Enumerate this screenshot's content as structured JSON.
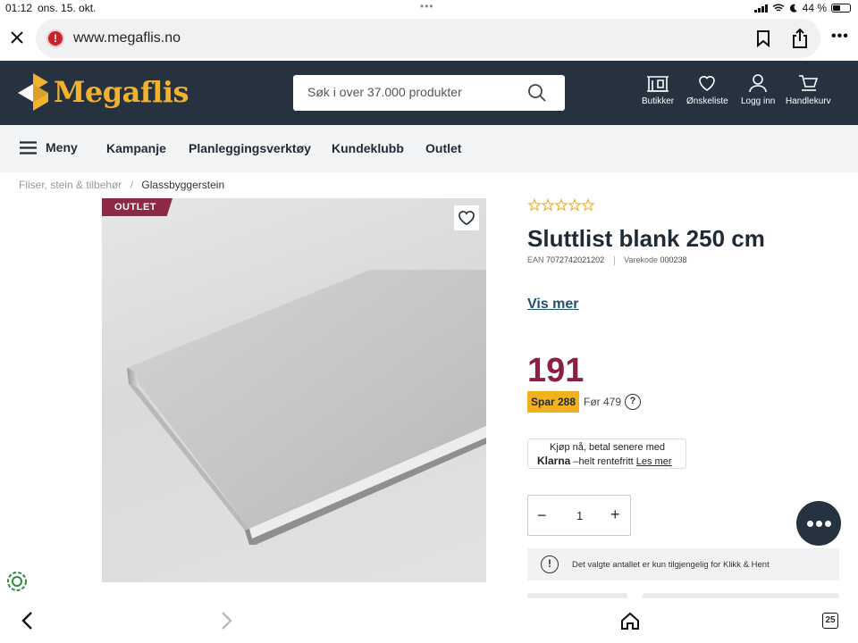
{
  "status": {
    "time": "01:12",
    "date": "ons. 15. okt.",
    "battery": "44 %",
    "battery_level": 0.44
  },
  "browser": {
    "url": "www.megaflis.no",
    "tab_count": "25"
  },
  "header": {
    "logo_text": "Megaflis",
    "search_placeholder": "Søk i over 37.000 produkter",
    "nav": [
      {
        "label": "Butikker",
        "icon": "store-icon"
      },
      {
        "label": "Ønskeliste",
        "icon": "heart-icon"
      },
      {
        "label": "Logg inn",
        "icon": "user-icon"
      },
      {
        "label": "Handlekurv",
        "icon": "cart-icon"
      }
    ]
  },
  "main_nav": {
    "menu_label": "Meny",
    "links": [
      "Kampanje",
      "Planleggingsverktøy",
      "Kundeklubb",
      "Outlet"
    ]
  },
  "breadcrumb": {
    "parent": "Fliser, stein & tilbehør",
    "separator": "/",
    "current": "Glassbyggerstein"
  },
  "product": {
    "badge": "OUTLET",
    "rating_stars": 5,
    "rating_value": 0,
    "title": "Sluttlist blank 250 cm",
    "ean_label": "EAN",
    "ean": "7072742021202",
    "sku_label": "Varekode",
    "sku": "000238",
    "vis_mer": "Vis mer",
    "price": "191",
    "save_label": "Spar 288",
    "before_price": "Før 479",
    "help_symbol": "?",
    "klarna": {
      "line1": "Kjøp nå, betal senere med",
      "brand": "Klarna",
      "line2": "–helt rentefritt",
      "link": "Les mer"
    },
    "quantity": "1",
    "notice": "Det valgte antallet er kun tilgjengelig for Klikk & Hent"
  },
  "colors": {
    "header_bg": "#263240",
    "brand_gold": "#f2b230",
    "price": "#8d1f44",
    "badge": "#8d2846",
    "save_bg": "#f3b11f",
    "link": "#22506b"
  }
}
